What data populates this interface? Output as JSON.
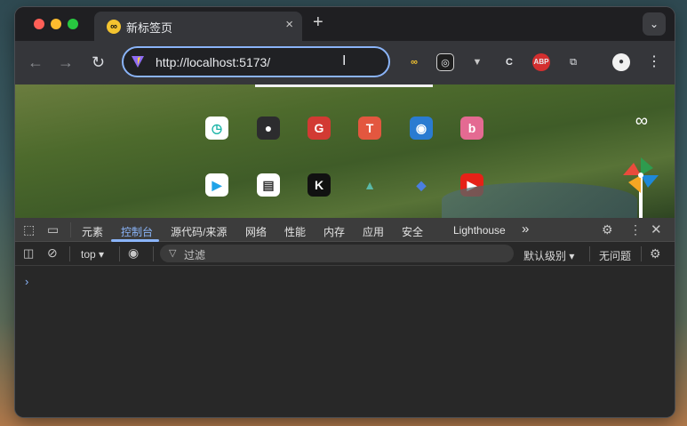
{
  "tab": {
    "title": "新标签页",
    "favicon": "infinity-icon"
  },
  "omnibox": {
    "url": "http://localhost:5173/"
  },
  "extensions": [
    {
      "name": "infinity-extension-icon",
      "glyph": "∞"
    },
    {
      "name": "glasses-extension-icon",
      "glyph": "◎"
    },
    {
      "name": "vue-devtools-extension-icon",
      "glyph": "▼"
    },
    {
      "name": "code-extension-icon",
      "glyph": "C"
    },
    {
      "name": "adblock-extension-icon",
      "glyph": "ABP"
    },
    {
      "name": "puzzle-extension-icon",
      "glyph": "⧉"
    },
    {
      "name": "profile-icon",
      "glyph": "●"
    },
    {
      "name": "more-menu-icon",
      "glyph": "⋮"
    }
  ],
  "shortcuts": [
    {
      "name": "clock-shortcut-icon",
      "glyph": "◷",
      "bg": "#ffffff",
      "fg": "#17b3a6"
    },
    {
      "name": "github-shortcut-icon",
      "glyph": "●",
      "bg": "#2c2c2e",
      "fg": "#ffffff"
    },
    {
      "name": "g-shortcut-icon",
      "glyph": "G",
      "bg": "#d23a33",
      "fg": "#ffffff"
    },
    {
      "name": "t-shortcut-icon",
      "glyph": "T",
      "bg": "#e3573f",
      "fg": "#ffffff"
    },
    {
      "name": "rss-shortcut-icon",
      "glyph": "◉",
      "bg": "#2a7bd1",
      "fg": "#ffffff"
    },
    {
      "name": "bilibili-shortcut-icon",
      "glyph": "b",
      "bg": "#e46a92",
      "fg": "#ffffff"
    },
    {
      "name": "play-shortcut-icon",
      "glyph": "▶",
      "bg": "#ffffff",
      "fg": "#1fa3e8"
    },
    {
      "name": "book-shortcut-icon",
      "glyph": "▤",
      "bg": "#ffffff",
      "fg": "#333333"
    },
    {
      "name": "k-shortcut-icon",
      "glyph": "K",
      "bg": "#111111",
      "fg": "#ffffff"
    },
    {
      "name": "mountain-shortcut-icon",
      "glyph": "▲",
      "bg": "transparent",
      "fg": "#5ab9a8"
    },
    {
      "name": "bird-shortcut-icon",
      "glyph": "◆",
      "bg": "transparent",
      "fg": "#4a7ee0"
    },
    {
      "name": "youtube-shortcut-icon",
      "glyph": "▶",
      "bg": "#e62117",
      "fg": "#ffffff"
    }
  ],
  "devtools": {
    "tabs": [
      "元素",
      "控制台",
      "源代码/来源",
      "网络",
      "性能",
      "内存",
      "应用",
      "安全",
      "Lighthouse"
    ],
    "more_tabs": "»",
    "context": "top ▾",
    "filter_placeholder": "过滤",
    "log_level": "默认级别 ▾",
    "issues": "无问题",
    "prompt": "›"
  },
  "colors": {
    "accent": "#8ab4f8"
  }
}
